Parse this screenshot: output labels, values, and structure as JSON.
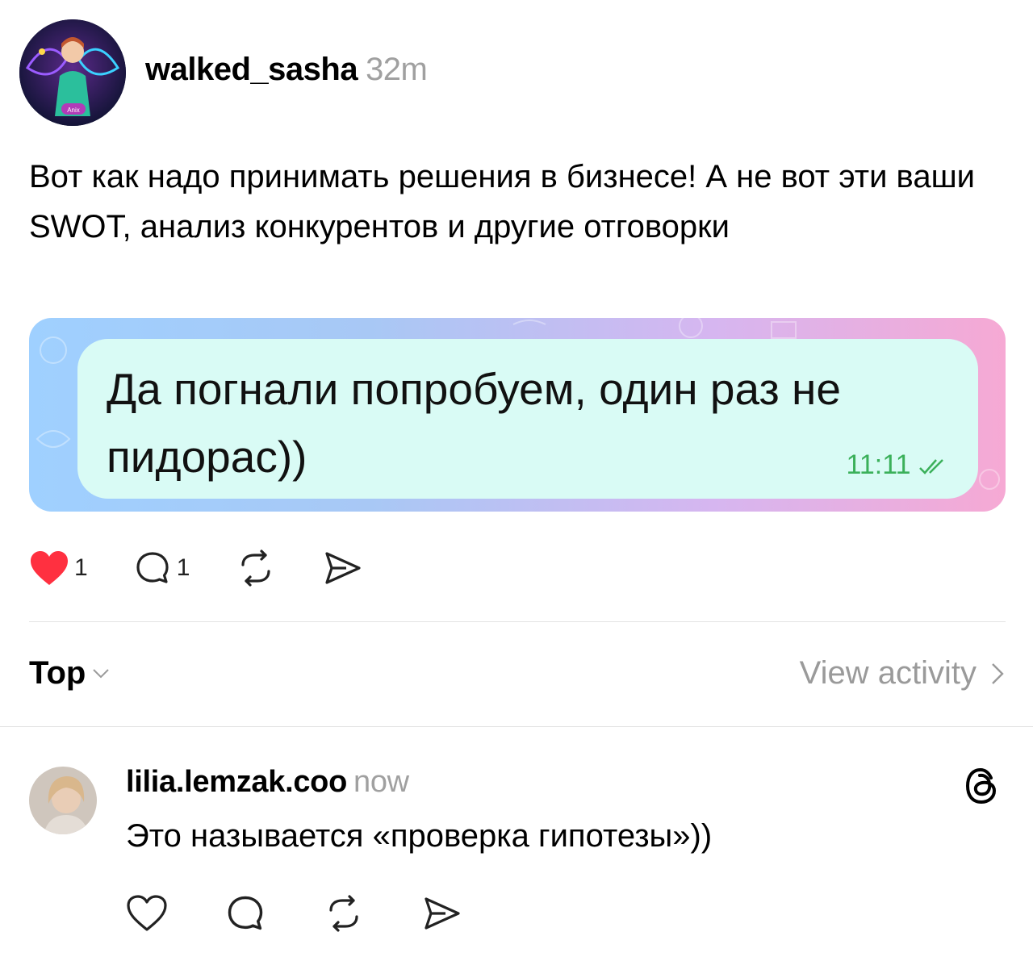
{
  "post": {
    "username": "walked_sasha",
    "time": "32m",
    "avatar_badge": "Anix",
    "text": "Вот как надо принимать решения в бизнесе! А не вот эти ваши SWOT, анализ конкурентов и другие отговорки",
    "image": {
      "message": "Да погнали попробуем, один раз не пидорас))",
      "time": "11:11"
    },
    "actions": {
      "likes": "1",
      "comments": "1"
    }
  },
  "sort": {
    "label": "Top",
    "view_activity": "View activity"
  },
  "reply": {
    "username": "lilia.lemzak.coo",
    "time": "now",
    "text": "Это называется «проверка гипотезы»))"
  },
  "colors": {
    "like_red": "#ff3040",
    "telegram_bubble": "#d9fbf5",
    "telegram_check": "#3bb05a",
    "muted_gray": "#a0a0a0"
  },
  "icons": [
    "heart-icon",
    "comment-icon",
    "repost-icon",
    "share-icon",
    "chevron-down-icon",
    "chevron-right-icon",
    "threads-logo-icon",
    "double-check-icon"
  ]
}
